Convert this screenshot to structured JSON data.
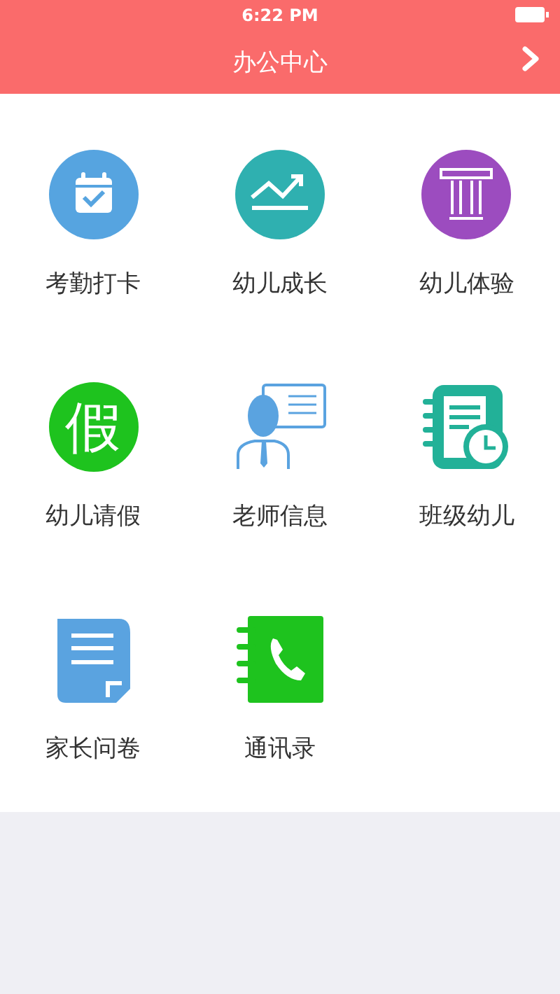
{
  "status_bar": {
    "time": "6:22 PM"
  },
  "header": {
    "title": "办公中心"
  },
  "items": [
    {
      "label": "考勤打卡",
      "kind": "calendar"
    },
    {
      "label": "幼儿成长",
      "kind": "growth"
    },
    {
      "label": "幼儿体验",
      "kind": "pillar"
    },
    {
      "label": "幼儿请假",
      "kind": "glyph",
      "glyph": "假"
    },
    {
      "label": "老师信息",
      "kind": "teacher"
    },
    {
      "label": "班级幼儿",
      "kind": "roster"
    },
    {
      "label": "家长问卷",
      "kind": "document"
    },
    {
      "label": "通讯录",
      "kind": "phonebook"
    }
  ]
}
